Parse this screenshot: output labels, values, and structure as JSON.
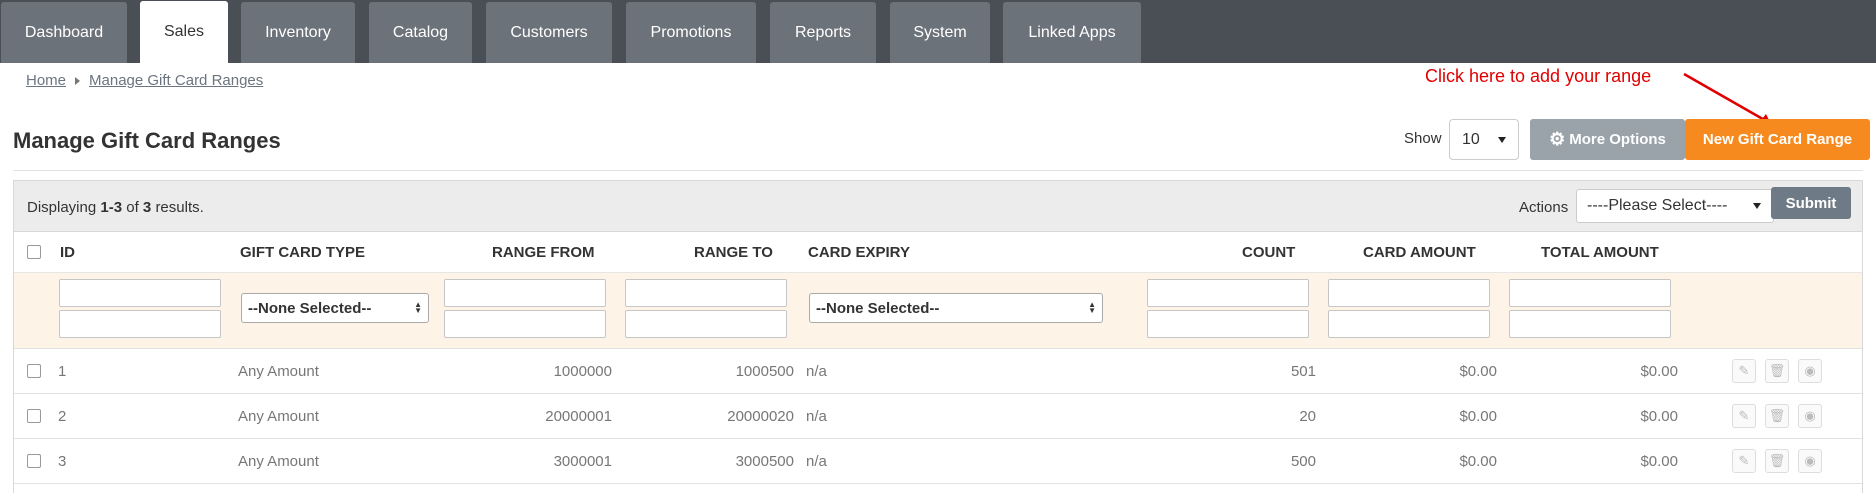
{
  "nav": {
    "tabs": [
      {
        "label": "Dashboard"
      },
      {
        "label": "Sales"
      },
      {
        "label": "Inventory"
      },
      {
        "label": "Catalog"
      },
      {
        "label": "Customers"
      },
      {
        "label": "Promotions"
      },
      {
        "label": "Reports"
      },
      {
        "label": "System"
      },
      {
        "label": "Linked Apps"
      }
    ],
    "active": "Sales"
  },
  "breadcrumb": {
    "home": "Home",
    "current": "Manage Gift Card Ranges"
  },
  "page": {
    "title": "Manage Gift Card Ranges"
  },
  "toolbar": {
    "show_label": "Show",
    "show_value": "10",
    "more_options": "More Options",
    "new_range": "New Gift Card Range"
  },
  "annotation": {
    "text": "Click here to add your range",
    "color": "#e00000"
  },
  "grid": {
    "summary_prefix": "Displaying",
    "summary_range": "1-3",
    "summary_of": "of",
    "summary_total": "3",
    "summary_suffix": "results.",
    "actions_label": "Actions",
    "actions_value": "----Please Select----",
    "submit": "Submit",
    "columns": {
      "id": "ID",
      "type": "GIFT CARD TYPE",
      "from": "RANGE FROM",
      "to": "RANGE TO",
      "expiry": "CARD EXPIRY",
      "count": "COUNT",
      "card_amount": "CARD AMOUNT",
      "total_amount": "TOTAL AMOUNT"
    },
    "filters": {
      "type_placeholder": "--None Selected--",
      "expiry_placeholder": "--None Selected--"
    },
    "rows": [
      {
        "id": "1",
        "type": "Any Amount",
        "from": "1000000",
        "to": "1000500",
        "expiry": "n/a",
        "count": "501",
        "card_amount": "$0.00",
        "total_amount": "$0.00"
      },
      {
        "id": "2",
        "type": "Any Amount",
        "from": "20000001",
        "to": "20000020",
        "expiry": "n/a",
        "count": "20",
        "card_amount": "$0.00",
        "total_amount": "$0.00"
      },
      {
        "id": "3",
        "type": "Any Amount",
        "from": "3000001",
        "to": "3000500",
        "expiry": "n/a",
        "count": "500",
        "card_amount": "$0.00",
        "total_amount": "$0.00"
      }
    ]
  },
  "colors": {
    "accent_orange": "#f68a1f",
    "nav_bg": "#4a4f55",
    "filter_bg": "#fdf3e7"
  }
}
